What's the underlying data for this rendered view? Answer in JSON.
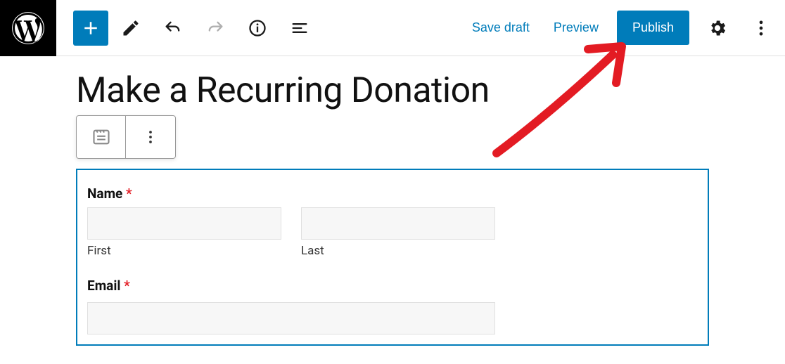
{
  "topbar": {
    "save_draft_label": "Save draft",
    "preview_label": "Preview",
    "publish_label": "Publish"
  },
  "page": {
    "title": "Make a Recurring Donation"
  },
  "form": {
    "name_label": "Name",
    "name_required": "*",
    "first_label": "First",
    "last_label": "Last",
    "email_label": "Email",
    "email_required": "*"
  },
  "colors": {
    "accent": "#007cba",
    "required": "#e31b23"
  }
}
